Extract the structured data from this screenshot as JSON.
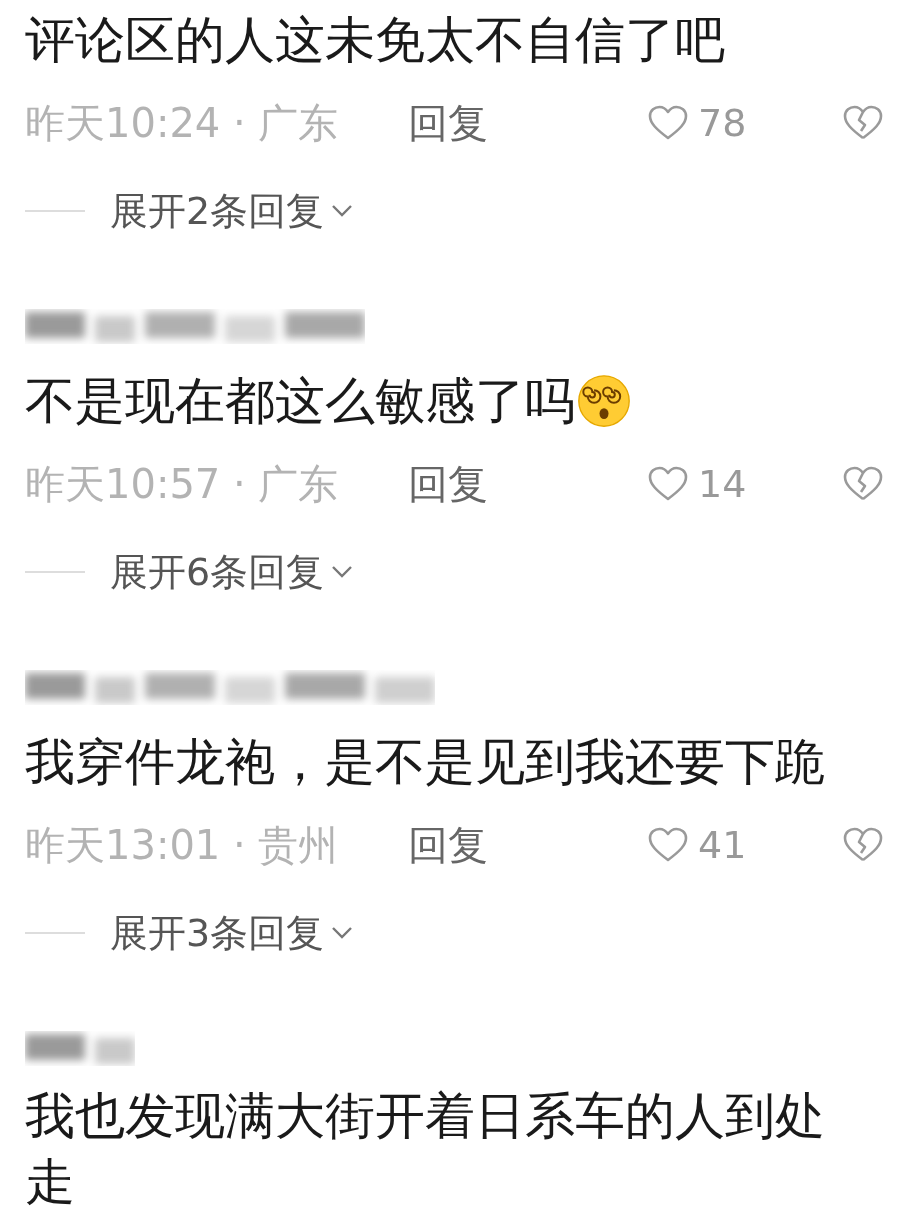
{
  "comments": [
    {
      "text": "评论区的人这未免太不自信了吧",
      "time": "昨天10:24",
      "separator": "·",
      "location": "广东",
      "reply": "回复",
      "likes": "78",
      "expand": "展开2条回复"
    },
    {
      "author": {
        "kind": "blurred"
      },
      "text": "不是现在都这么敏感了吗",
      "emoji": {
        "kind": "dizzy"
      },
      "time": "昨天10:57",
      "separator": "·",
      "location": "广东",
      "reply": "回复",
      "likes": "14",
      "expand": "展开6条回复"
    },
    {
      "author": {
        "kind": "blurred"
      },
      "text": "我穿件龙袍，是不是见到我还要下跪",
      "time": "昨天13:01",
      "separator": "·",
      "location": "贵州",
      "reply": "回复",
      "likes": "41",
      "expand": "展开3条回复"
    },
    {
      "author": {
        "kind": "blurred"
      },
      "text": "我也发现满大街开着日系车的人到处走"
    }
  ]
}
